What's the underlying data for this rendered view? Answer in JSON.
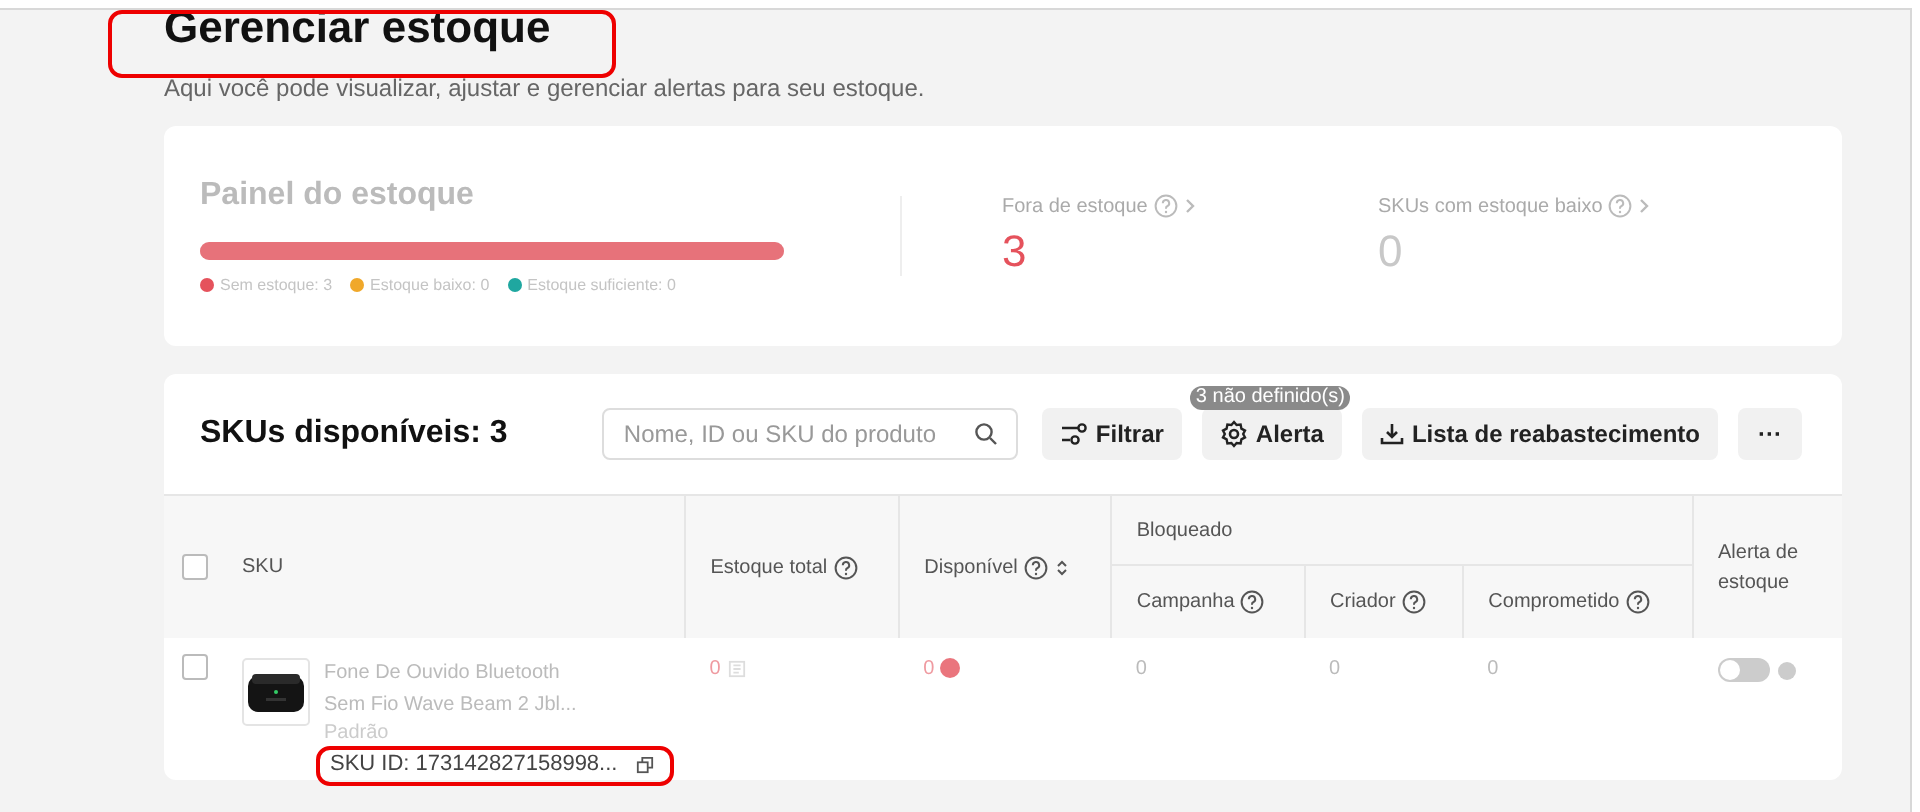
{
  "page": {
    "title": "Gerenciar estoque",
    "title_highlighted": true,
    "subtitle": "Aqui você pode visualizar, ajustar e gerenciar alertas para seu estoque."
  },
  "panel": {
    "title": "Painel do estoque",
    "legend": [
      {
        "label": "Sem estoque: 3",
        "color": "#e5525c",
        "level": 1
      },
      {
        "label": "Estoque baixo: 0",
        "color": "#f0a82a"
      },
      {
        "label": "Estoque suficiente: 0",
        "color": "#1fa7a0"
      }
    ],
    "stats": [
      {
        "label": "Fora de estoque",
        "value": "3",
        "color": "#e5525c"
      },
      {
        "label": "SKUs com estoque baixo",
        "value": "0",
        "color": "#c8c8c8"
      }
    ]
  },
  "toolbar": {
    "heading": "SKUs disponíveis: 3",
    "search": {
      "placeholder": "Nome, ID ou SKU do produto"
    },
    "buttons": [
      {
        "kind": "filter",
        "label": "Filtrar"
      },
      {
        "kind": "alert",
        "label": "Alerta",
        "badge": "3 não definido(s)"
      },
      {
        "kind": "download",
        "label": "Lista de reabastecimento"
      },
      {
        "kind": "more",
        "label": "···"
      }
    ]
  },
  "table": {
    "select_all": {
      "checked": false
    },
    "columns": {
      "sku": "SKU",
      "total": "Estoque total",
      "available": "Disponível",
      "blocked": "Bloqueado",
      "campaign": "Campanha",
      "creator": "Criador",
      "committed": "Comprometido",
      "alert": "Alerta de estoque"
    },
    "rows": [
      {
        "checked": false,
        "name": "Fone De Ouvido Bluetooth Sem Fio Wave Beam 2 Jbl...",
        "variant": "Padrão",
        "sku_id": "SKU ID: 173142827158998...",
        "sku_id_highlighted": true,
        "total": "0",
        "available": "0",
        "campaign": "0",
        "creator": "0",
        "committed": "0",
        "alert_on": false
      }
    ]
  }
}
